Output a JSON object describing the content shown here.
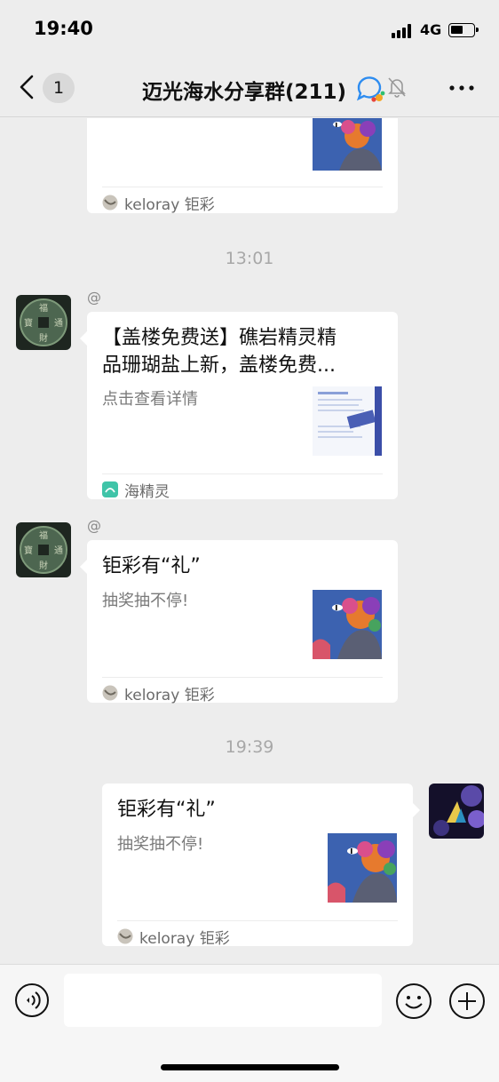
{
  "status_bar": {
    "time": "19:40",
    "network": "4G"
  },
  "nav": {
    "unread_count": "1",
    "title": "迈光海水分享群(211)"
  },
  "messages": [
    {
      "type": "card",
      "source_label": "keloray 钜彩"
    },
    {
      "type": "time",
      "text": "13:01"
    },
    {
      "type": "card",
      "sender": "@",
      "title_line1": "【盖楼免费送】礁岩精灵精",
      "title_line2": "品珊瑚盐上新，盖楼免费...",
      "desc": "点击查看详情",
      "source_label": "海精灵"
    },
    {
      "type": "card",
      "sender": "@",
      "title": "钜彩有“礼”",
      "desc": "抽奖抽不停!",
      "source_label": "keloray 钜彩"
    },
    {
      "type": "time",
      "text": "19:39"
    },
    {
      "type": "card",
      "outgoing": true,
      "title": "钜彩有“礼”",
      "desc": "抽奖抽不停!",
      "source_label": "keloray 钜彩"
    }
  ],
  "input": {
    "placeholder": ""
  },
  "colors": {
    "background": "#ededed",
    "bubble": "#ffffff",
    "accent_icon": "#2d8cf0"
  },
  "icons": [
    "back-icon",
    "chat-bubble-icon",
    "mute-bell-icon",
    "more-dots-icon",
    "voice-icon",
    "emoji-icon",
    "plus-icon"
  ]
}
